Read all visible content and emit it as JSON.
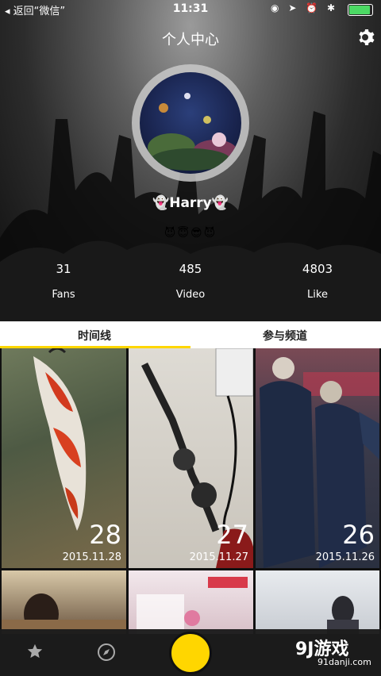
{
  "status_bar": {
    "back_label": "◂ 返回“微信”",
    "time": "11:31",
    "icons_text": "◉ ➤ ⏰ ✱",
    "battery_color": "#4cd964"
  },
  "header": {
    "title": "个人中心",
    "username": "👻Harry👻",
    "emojis": "😈😇😎😈"
  },
  "stats": [
    {
      "value": "31",
      "label": "Fans"
    },
    {
      "value": "485",
      "label": "Video"
    },
    {
      "value": "4803",
      "label": "Like"
    }
  ],
  "tabs": [
    {
      "label": "时间线",
      "active": true
    },
    {
      "label": "参与频道",
      "active": false
    }
  ],
  "videos": [
    {
      "day": "28",
      "date": "2015.11.28"
    },
    {
      "day": "27",
      "date": "2015.11.27"
    },
    {
      "day": "26",
      "date": "2015.11.26"
    }
  ],
  "bottom_bar": {
    "accent_color": "#ffd600",
    "icons": [
      "star-icon",
      "compass-icon",
      "record-button"
    ]
  },
  "watermark": {
    "logo": "9J游戏",
    "url": "91danji.com"
  }
}
